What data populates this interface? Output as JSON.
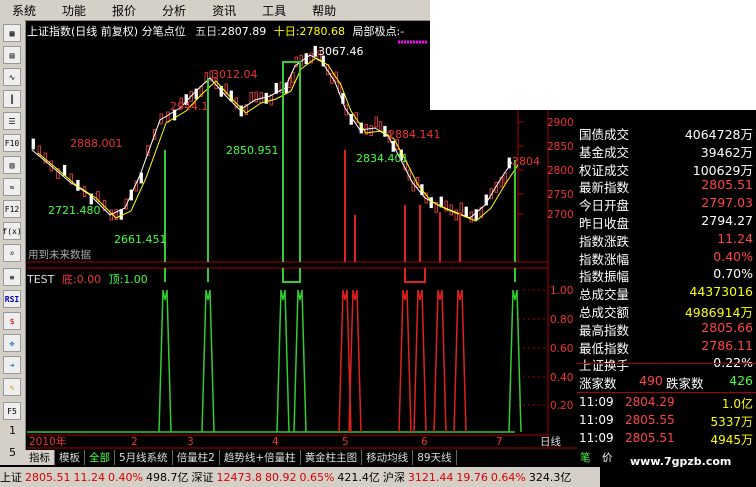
{
  "menu": [
    "系统",
    "功能",
    "报价",
    "分析",
    "资讯",
    "工具",
    "帮助"
  ],
  "toolbar_numbers": [
    "1",
    "5"
  ],
  "chart": {
    "title": "上证指数(日线 前复权) 分笔点位",
    "label_5day": "五日:",
    "value_5day": "2807.89",
    "label_10day": "十日:",
    "value_10day": "2780.68",
    "extreme_label": "局部极点:-",
    "price_labels": [
      "3067.46",
      "3012.04",
      "2944.1",
      "2888.001",
      "2850.951",
      "2834.401",
      "2884.141",
      "2721.480",
      "2661.451",
      "2804"
    ],
    "future_text": "用到未来数据",
    "y_ticks": [
      "2900",
      "2850",
      "2800",
      "2750",
      "2700"
    ],
    "year_label": "2010年",
    "month_labels": [
      "2",
      "3",
      "4",
      "5",
      "6",
      "7"
    ],
    "period_label": "日线"
  },
  "indicator": {
    "name": "TEST",
    "bottom_label": "底:",
    "bottom_value": "0.00",
    "top_label": "顶:",
    "top_value": "1.00",
    "y_ticks": [
      "1.00",
      "0.80",
      "0.60",
      "0.40",
      "0.20"
    ]
  },
  "info_panel": [
    {
      "k": "国债成交",
      "v": "4064728万",
      "c": "#fff"
    },
    {
      "k": "基金成交",
      "v": "39462万",
      "c": "#fff"
    },
    {
      "k": "权证成交",
      "v": "100629万",
      "c": "#fff"
    },
    {
      "k": "最新指数",
      "v": "2805.51",
      "c": "#f44"
    },
    {
      "k": "今日开盘",
      "v": "2797.03",
      "c": "#f44"
    },
    {
      "k": "昨日收盘",
      "v": "2794.27",
      "c": "#fff"
    },
    {
      "k": "指数涨跌",
      "v": "11.24",
      "c": "#f44"
    },
    {
      "k": "指数涨幅",
      "v": "0.40%",
      "c": "#f44"
    },
    {
      "k": "指数振幅",
      "v": "0.70%",
      "c": "#fff"
    },
    {
      "k": "总成交量",
      "v": "44373016",
      "c": "#ff0"
    },
    {
      "k": "总成交额",
      "v": "4986914万",
      "c": "#ff0"
    },
    {
      "k": "最高指数",
      "v": "2805.66",
      "c": "#f44"
    },
    {
      "k": "最低指数",
      "v": "2786.11",
      "c": "#f44"
    },
    {
      "k": "上证换手",
      "v": "0.22%",
      "c": "#fff"
    }
  ],
  "advance": {
    "label_up": "涨家数",
    "value_up": "490",
    "label_down": "跌家数",
    "value_down": "426"
  },
  "ticks": [
    {
      "time": "11:09",
      "price": "2804.29",
      "vol": "1.0亿"
    },
    {
      "time": "11:09",
      "price": "2805.55",
      "vol": "5337万"
    },
    {
      "time": "11:09",
      "price": "2805.51",
      "vol": "4945万"
    }
  ],
  "bottom_tabs": [
    "指标",
    "模板",
    "全部",
    "5月线系统",
    "倍量柱2",
    "趋势线+倍量柱",
    "黄金柱主图",
    "移动均线",
    "89天线"
  ],
  "bottom_right": [
    "笔",
    "价"
  ],
  "status": [
    {
      "t": "上证",
      "c": "#000"
    },
    {
      "t": "2805.51",
      "c": "#d00"
    },
    {
      "t": "11.24",
      "c": "#d00"
    },
    {
      "t": "0.40%",
      "c": "#d00"
    },
    {
      "t": "498.7亿",
      "c": "#000"
    },
    {
      "t": "深证",
      "c": "#000"
    },
    {
      "t": "12473.8",
      "c": "#d00"
    },
    {
      "t": "80.92",
      "c": "#d00"
    },
    {
      "t": "0.65%",
      "c": "#d00"
    },
    {
      "t": "421.4亿",
      "c": "#000"
    },
    {
      "t": "沪深",
      "c": "#000"
    },
    {
      "t": "3121.44",
      "c": "#d00"
    },
    {
      "t": "19.76",
      "c": "#d00"
    },
    {
      "t": "0.64%",
      "c": "#d00"
    },
    {
      "t": "324.3亿",
      "c": "#000"
    }
  ],
  "watermark": "www.7gpzb.com"
}
